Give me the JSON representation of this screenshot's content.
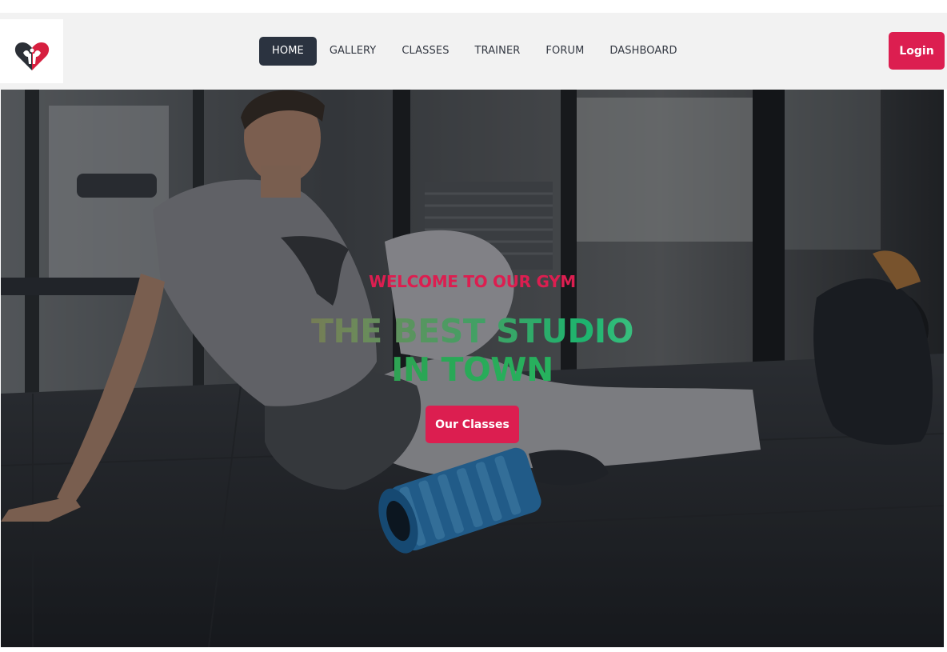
{
  "brand": {
    "logo_icon": "heart-muscle-logo",
    "accent_color": "#dc1e50",
    "nav_active_color": "#2b3340"
  },
  "nav": {
    "items": [
      {
        "label": "HOME",
        "active": true
      },
      {
        "label": "GALLERY",
        "active": false
      },
      {
        "label": "CLASSES",
        "active": false
      },
      {
        "label": "TRAINER",
        "active": false
      },
      {
        "label": "FORUM",
        "active": false
      },
      {
        "label": "DASHBOARD",
        "active": false
      }
    ],
    "login_label": "Login"
  },
  "hero": {
    "eyebrow": "WELCOME TO OUR GYM",
    "headline_line1": "THE BEST STUDIO",
    "headline_line2": "IN TOWN",
    "cta_label": "Our Classes",
    "image_subject": "man-with-foam-roller-in-gym"
  }
}
